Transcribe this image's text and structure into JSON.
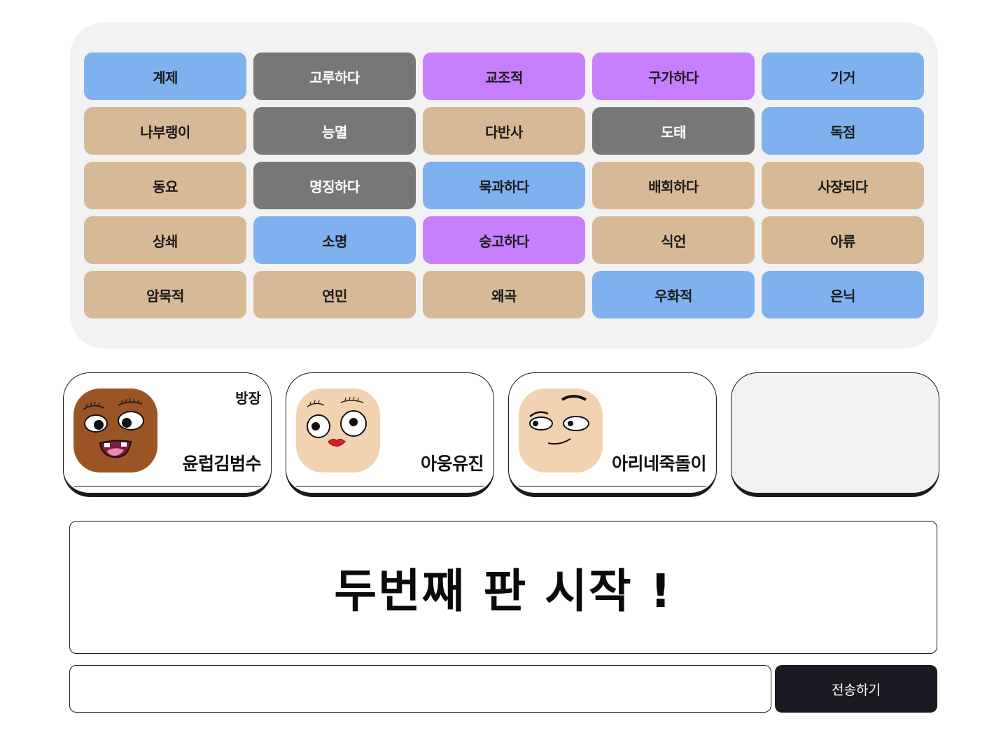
{
  "board": {
    "words": [
      {
        "label": "계제",
        "color": "blue"
      },
      {
        "label": "고루하다",
        "color": "gray"
      },
      {
        "label": "교조적",
        "color": "purple"
      },
      {
        "label": "구가하다",
        "color": "purple"
      },
      {
        "label": "기거",
        "color": "blue"
      },
      {
        "label": "나부랭이",
        "color": "tan"
      },
      {
        "label": "능멸",
        "color": "gray"
      },
      {
        "label": "다반사",
        "color": "tan"
      },
      {
        "label": "도태",
        "color": "gray"
      },
      {
        "label": "독점",
        "color": "blue"
      },
      {
        "label": "동요",
        "color": "tan"
      },
      {
        "label": "명징하다",
        "color": "gray"
      },
      {
        "label": "묵과하다",
        "color": "blue"
      },
      {
        "label": "배회하다",
        "color": "tan"
      },
      {
        "label": "사장되다",
        "color": "tan"
      },
      {
        "label": "상쇄",
        "color": "tan"
      },
      {
        "label": "소명",
        "color": "blue"
      },
      {
        "label": "숭고하다",
        "color": "purple"
      },
      {
        "label": "식언",
        "color": "tan"
      },
      {
        "label": "아류",
        "color": "tan"
      },
      {
        "label": "암묵적",
        "color": "tan"
      },
      {
        "label": "연민",
        "color": "tan"
      },
      {
        "label": "왜곡",
        "color": "tan"
      },
      {
        "label": "우화적",
        "color": "blue"
      },
      {
        "label": "은닉",
        "color": "blue"
      }
    ],
    "colors": {
      "blue": "#7fb1ee",
      "gray": "#777777",
      "purple": "#c77ffd",
      "tan": "#d6b997",
      "panel": "#f2f2f2"
    }
  },
  "players": [
    {
      "name": "윤럽김범수",
      "badge": "방장",
      "avatar": "brown-face-avatar",
      "skin": "#9b5524"
    },
    {
      "name": "아웅유진",
      "badge": "",
      "avatar": "surprised-face-avatar",
      "skin": "#f2d3b1"
    },
    {
      "name": "아리네죽돌이",
      "badge": "",
      "avatar": "smirk-face-avatar",
      "skin": "#f2d3b1"
    },
    {
      "name": "",
      "badge": "",
      "avatar": "",
      "skin": ""
    }
  ],
  "message": {
    "text": "두번째 판 시작 !"
  },
  "chat": {
    "input_value": "",
    "placeholder": "",
    "send_label": "전송하기"
  }
}
